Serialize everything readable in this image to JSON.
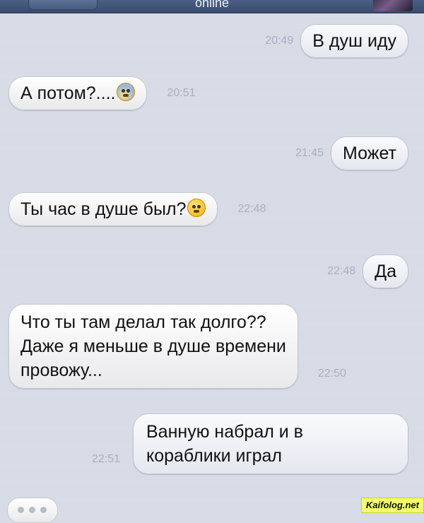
{
  "header": {
    "status": "online"
  },
  "messages": [
    {
      "dir": "out",
      "time": "20:49",
      "text": "В душ иду"
    },
    {
      "dir": "in",
      "time": "20:51",
      "text": "А потом?....",
      "emoji": "anxious-face-icon"
    },
    {
      "dir": "out",
      "time": "21:45",
      "text": "Может"
    },
    {
      "dir": "in",
      "time": "22:48",
      "text": "Ты час в душе был?",
      "emoji": "flushed-face-icon"
    },
    {
      "dir": "out",
      "time": "22:48",
      "text": "Да"
    },
    {
      "dir": "in",
      "time": "22:50",
      "lines": [
        "Что ты там делал так долго??",
        "Даже я меньше в душе времени",
        "провожу..."
      ]
    },
    {
      "dir": "out",
      "time": "22:51",
      "lines": [
        "Ванную набрал и в",
        "кораблики играл"
      ]
    }
  ],
  "typing_indicator": "typing-dots-icon",
  "watermark": "Kaifolog.net"
}
